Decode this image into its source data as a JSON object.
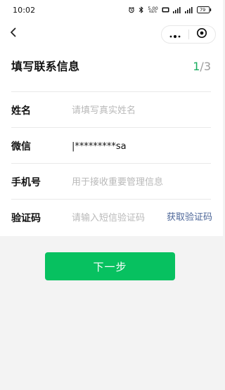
{
  "status_bar": {
    "time": "10:02",
    "network_speed_value": "5.00",
    "network_speed_unit": "KB/S",
    "battery_level": "79"
  },
  "nav": {
    "back_icon": "chevron-left-icon",
    "more_icon": "ellipsis-icon",
    "close_icon": "record-circle-icon"
  },
  "header": {
    "title": "填写联系信息",
    "step_current": "1",
    "step_separator": "/",
    "step_total": "3"
  },
  "form": {
    "name": {
      "label": "姓名",
      "value": "",
      "placeholder": "请填写真实姓名"
    },
    "wechat": {
      "label": "微信",
      "value": "|*********sa",
      "placeholder": ""
    },
    "phone": {
      "label": "手机号",
      "value": "",
      "placeholder": "用于接收重要管理信息"
    },
    "verification": {
      "label": "验证码",
      "value": "",
      "placeholder": "请输入短信验证码",
      "get_code_label": "获取验证码"
    }
  },
  "actions": {
    "next_label": "下一步"
  },
  "colors": {
    "accent": "#07c160",
    "step_active": "#1aad5f",
    "link": "#4d6799",
    "placeholder": "#b9b9b9",
    "background": "#f3f3f3"
  }
}
